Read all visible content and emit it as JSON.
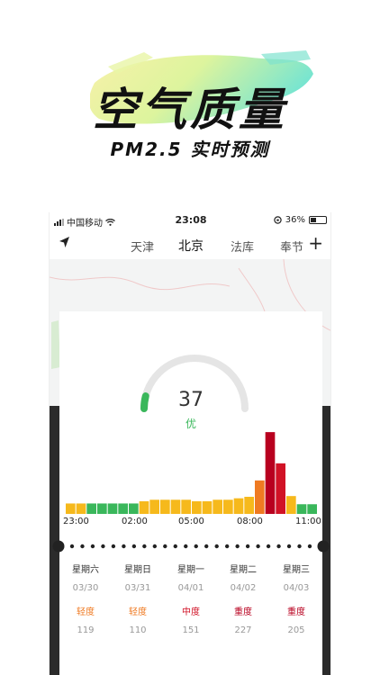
{
  "promo": {
    "title": "空气质量",
    "subtitle": "PM2.5 实时预测"
  },
  "status_bar": {
    "carrier": "中国移动",
    "time": "23:08",
    "battery": "36%"
  },
  "nav": {
    "tabs": [
      "天津",
      "北京",
      "法库",
      "奉节"
    ],
    "active_tab": "北京"
  },
  "aqi": {
    "value": "37",
    "level": "优",
    "level_color": "#3ab75b",
    "fraction": 0.08
  },
  "chart_data": {
    "type": "bar",
    "x_ticks": [
      "23:00",
      "02:00",
      "05:00",
      "08:00",
      "11:00"
    ],
    "colors": {
      "good": "#3ab75b",
      "moderate": "#f6b91c",
      "unhealthy_sensitive": "#ef7a22",
      "unhealthy": "#b8001f",
      "very_unhealthy": "#d11226"
    },
    "values": [
      14,
      14,
      14,
      14,
      14,
      14,
      14,
      17,
      19,
      19,
      19,
      19,
      17,
      17,
      19,
      19,
      21,
      23,
      45,
      110,
      68,
      24,
      13,
      13
    ],
    "bar_levels": [
      "moderate",
      "moderate",
      "good",
      "good",
      "good",
      "good",
      "good",
      "moderate",
      "moderate",
      "moderate",
      "moderate",
      "moderate",
      "moderate",
      "moderate",
      "moderate",
      "moderate",
      "moderate",
      "moderate",
      "unhealthy_sensitive",
      "unhealthy",
      "very_unhealthy",
      "moderate",
      "good",
      "good"
    ],
    "ylim": [
      0,
      115
    ]
  },
  "forecast": [
    {
      "day": "星期六",
      "date": "03/30",
      "level": "轻度",
      "color": "#ef7a22",
      "value": "119"
    },
    {
      "day": "星期日",
      "date": "03/31",
      "level": "轻度",
      "color": "#ef7a22",
      "value": "110"
    },
    {
      "day": "星期一",
      "date": "04/01",
      "level": "中度",
      "color": "#d11226",
      "value": "151"
    },
    {
      "day": "星期二",
      "date": "04/02",
      "level": "重度",
      "color": "#b8001f",
      "value": "227"
    },
    {
      "day": "星期三",
      "date": "04/03",
      "level": "重度",
      "color": "#b8001f",
      "value": "205"
    }
  ]
}
